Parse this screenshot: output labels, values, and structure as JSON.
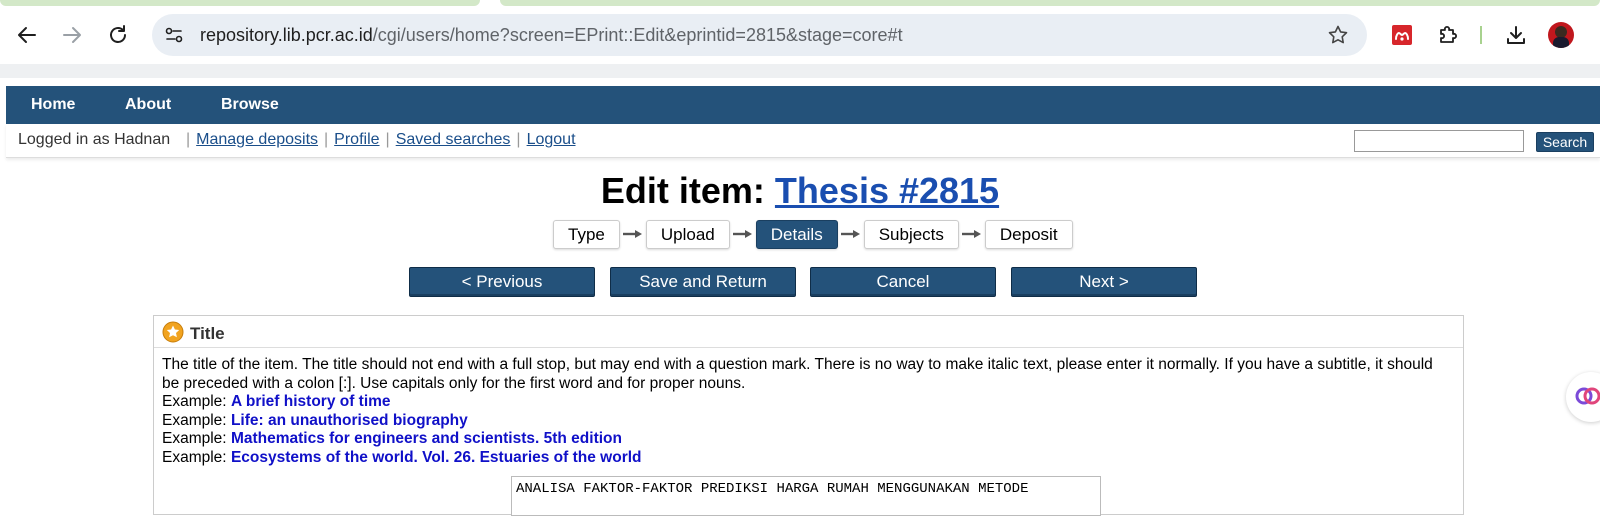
{
  "browser": {
    "url_host": "repository.lib.pcr.ac.id",
    "url_path": "/cgi/users/home?screen=EPrint::Edit&eprintid=2815&stage=core#t"
  },
  "site_nav": {
    "items": [
      "Home",
      "About",
      "Browse"
    ]
  },
  "user_bar": {
    "logged_in": "Logged in as Hadnan",
    "links": [
      "Manage deposits",
      "Profile",
      "Saved searches",
      "Logout"
    ],
    "search_label": "Search",
    "search_value": ""
  },
  "page": {
    "title_prefix": "Edit item: ",
    "title_link": "Thesis #2815",
    "stages": [
      {
        "label": "Type",
        "active": false
      },
      {
        "label": "Upload",
        "active": false
      },
      {
        "label": "Details",
        "active": true
      },
      {
        "label": "Subjects",
        "active": false
      },
      {
        "label": "Deposit",
        "active": false
      }
    ],
    "actions": [
      "< Previous",
      "Save and Return",
      "Cancel",
      "Next >"
    ]
  },
  "field": {
    "title": "Title",
    "help": "The title of the item. The title should not end with a full stop, but may end with a question mark. There is no way to make italic text, please enter it normally. If you have a subtitle, it should be preceded with a colon [:]. Use capitals only for the first word and for proper nouns.",
    "example_label": "Example:",
    "examples": [
      "A brief history of time",
      "Life: an unauthorised biography",
      "Mathematics for engineers and scientists. 5th edition",
      "Ecosystems of the world. Vol. 26. Estuaries of the world"
    ],
    "value": "ANALISA FAKTOR-FAKTOR PREDIKSI HARGA RUMAH MENGGUNAKAN METODE"
  },
  "colors": {
    "nav_bg": "#24527a",
    "link": "#1a4eb0",
    "example": "#1010c8"
  }
}
